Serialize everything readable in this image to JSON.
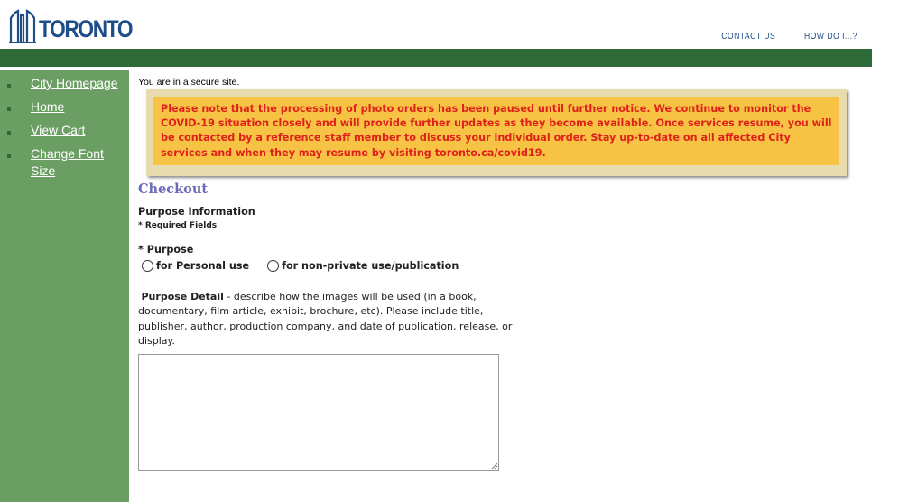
{
  "brand": {
    "logo_text": "TORONTO"
  },
  "top_nav": {
    "contact": "CONTACT US",
    "howdoi": "HOW DO I...?"
  },
  "sidebar": {
    "items": [
      {
        "label": "City Homepage"
      },
      {
        "label": "Home"
      },
      {
        "label": "View Cart"
      },
      {
        "label": "Change Font Size"
      }
    ]
  },
  "main": {
    "secure_text": "You are in a secure site.",
    "notice": "Please note that the processing of photo orders has been paused until further notice. We continue to monitor the COVID-19 situation closely and will provide further updates as they become available. Once services resume, you will be contacted by a reference staff member to discuss your individual order. Stay up-to-date on all affected City services and when they may resume by visiting toronto.ca/covid19.",
    "checkout_title": "Checkout",
    "purpose_info": "Purpose Information",
    "required_fields": "* Required Fields",
    "purpose_label": "* Purpose",
    "radio_personal": "for Personal use",
    "radio_nonprivate": "for non-private use/publication",
    "detail_label": "Purpose Detail",
    "detail_text": " - describe how the images will be used (in a book, documentary, film article, exhibit, brochure, etc). Please include title, publisher, author, production company, and date of publication, release, or display.",
    "textarea_value": ""
  },
  "colors": {
    "brand_blue": "#1d4e8a",
    "green_bar": "#2f6b38",
    "sidebar": "#6b9e63",
    "notice_bg": "#f6c344",
    "notice_text": "#e0201b"
  }
}
